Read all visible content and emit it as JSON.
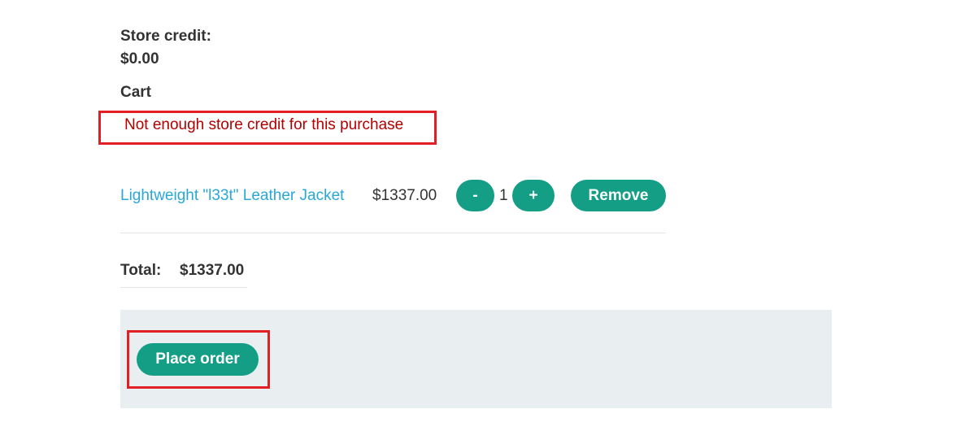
{
  "store_credit": {
    "label": "Store credit:",
    "value": "$0.00"
  },
  "cart": {
    "heading": "Cart",
    "error_message": "Not enough store credit for this purchase",
    "items": [
      {
        "name": "Lightweight \"l33t\" Leather Jacket",
        "price": "$1337.00",
        "quantity": "1",
        "decrement_label": "-",
        "increment_label": "+",
        "remove_label": "Remove"
      }
    ],
    "total_label": "Total:",
    "total_value": "$1337.00"
  },
  "checkout": {
    "place_order_label": "Place order"
  },
  "colors": {
    "accent": "#149e86",
    "link": "#29a8d8",
    "error_text": "#b50000",
    "highlight_border": "#e31f26",
    "panel_bg": "#e9eef1"
  }
}
